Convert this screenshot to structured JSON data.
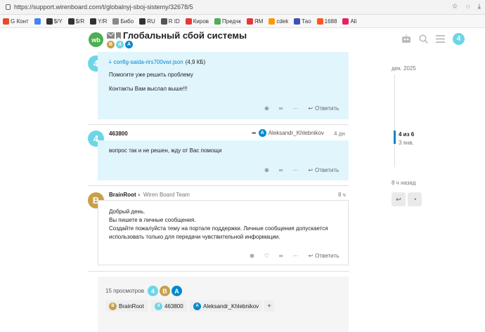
{
  "browser": {
    "url": "https://support.wirenboard.com/t/globalnyj-sboj-sistemy/32678/5",
    "bookmarks": [
      "G Конт",
      "$/Y",
      "$/R",
      "Y/R",
      "Бибо",
      "RU",
      "R ID",
      "Киров",
      "Предчк",
      "ЯМ",
      "cdek",
      "Тао",
      "1688",
      "Ali"
    ]
  },
  "header": {
    "logo": "wb",
    "title": "Глобальный сбой системы",
    "avatars": [
      {
        "letter": "B",
        "color": "#c8a048"
      },
      {
        "letter": "4",
        "color": "#6dd5e8"
      },
      {
        "letter": "A",
        "color": "#0088cc"
      }
    ],
    "badge": "4"
  },
  "colors": {
    "accent": "#0088cc",
    "cyan_avatar": "#6dd5e8",
    "brain_avatar": "#c8a048",
    "post_bg": "#e1f5fd"
  },
  "posts": [
    {
      "avatar": "4",
      "attachment": "config-saida-rirs700vwr.json",
      "attachment_size": "(4,9 КБ)",
      "lines": [
        "Помогите уже решить проблему",
        "Контакты Вам выслал выше!!!"
      ],
      "reply_label": "Ответить"
    },
    {
      "avatar": "4",
      "username": "463800",
      "reply_to": "Aleksandr_Khlebnikov",
      "time": "4 дн",
      "lines": [
        "вопрос так и не решен, жду от Вас помощи"
      ],
      "reply_label": "Ответить"
    },
    {
      "avatar": "B",
      "username": "BrainRoot",
      "group": "Wiren Board Team",
      "time": "8 ч",
      "lines": [
        "Добрый день.",
        "Вы пишете в личные сообщения.",
        "Создайте пожалуйста тему на портале поддержки. Личные сообщения допускается",
        "использовать только для передачи чувствительной информации."
      ],
      "reply_label": "Ответить"
    }
  ],
  "timeline": {
    "top_date": "дек. 2025",
    "position": "4 из 6",
    "position_date": "3 янв.",
    "bottom_ago": "8 ч назад"
  },
  "footer": {
    "views": "15 просмотров",
    "avatars": [
      "4",
      "B",
      "A"
    ],
    "participants": [
      {
        "avatar": "B",
        "name": "BrainRoot"
      },
      {
        "avatar": "4",
        "name": "463800"
      },
      {
        "avatar": "A",
        "name": "Aleksandr_Khlebnikov"
      }
    ],
    "plus": "+"
  }
}
